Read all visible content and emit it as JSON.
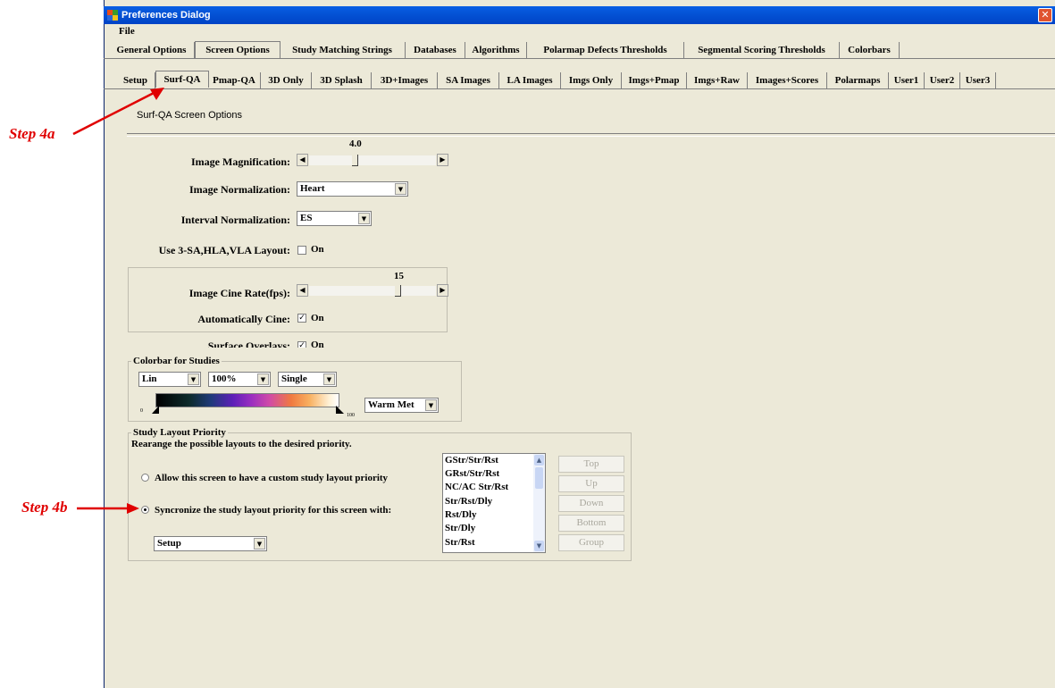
{
  "window": {
    "title": "Preferences Dialog",
    "close_glyph": "✕"
  },
  "menu": {
    "file": "File"
  },
  "main_tabs": [
    "General Options",
    "Screen Options",
    "Study Matching Strings",
    "Databases",
    "Algorithms",
    "Polarmap Defects Thresholds",
    "Segmental Scoring Thresholds",
    "Colorbars"
  ],
  "sub_tabs": [
    "Setup",
    "Surf-QA",
    "Pmap-QA",
    "3D Only",
    "3D Splash",
    "3D+Images",
    "SA Images",
    "LA Images",
    "Imgs Only",
    "Imgs+Pmap",
    "Imgs+Raw",
    "Images+Scores",
    "Polarmaps",
    "User1",
    "User2",
    "User3"
  ],
  "section_title": "Surf-QA Screen Options",
  "image_magnification": {
    "label": "Image Magnification:",
    "value": "4.0"
  },
  "image_normalization": {
    "label": "Image Normalization:",
    "value": "Heart"
  },
  "interval_normalization": {
    "label": "Interval Normalization:",
    "value": "ES"
  },
  "layout_3sa": {
    "label": "Use 3-SA,HLA,VLA Layout:",
    "on": "On",
    "checked": false
  },
  "cine_rate": {
    "label": "Image Cine Rate(fps):",
    "value": "15"
  },
  "auto_cine": {
    "label": "Automatically Cine:",
    "on": "On",
    "checked": true
  },
  "surface_overlays": {
    "label": "Surface Overlays:",
    "on": "On",
    "checked": true
  },
  "colorbar": {
    "title": "Colorbar for Studies",
    "scale": "Lin",
    "percent": "100%",
    "mode": "Single",
    "min_label": "0",
    "max_label": "100",
    "palette": "Warm Met"
  },
  "layout_priority": {
    "title": "Study Layout Priority",
    "description": "Rearange the possible layouts to the desired priority.",
    "option_custom": "Allow this screen to have a custom study layout priority",
    "option_sync": "Syncronize the study layout priority  for this screen with:",
    "sync_with": "Setup",
    "list": [
      "GStr/Str/Rst",
      "GRst/Str/Rst",
      "NC/AC Str/Rst",
      "Str/Rst/Dly",
      "Rst/Dly",
      "Str/Dly",
      "Str/Rst"
    ],
    "buttons": {
      "top": "Top",
      "up": "Up",
      "down": "Down",
      "bottom": "Bottom",
      "group": "Group"
    }
  },
  "annotations": {
    "step4a": "Step 4a",
    "step4b": "Step 4b"
  },
  "colors": {
    "annotation": "#e00000",
    "titlebar": "#0453d6",
    "dialog": "#ece9d8"
  }
}
